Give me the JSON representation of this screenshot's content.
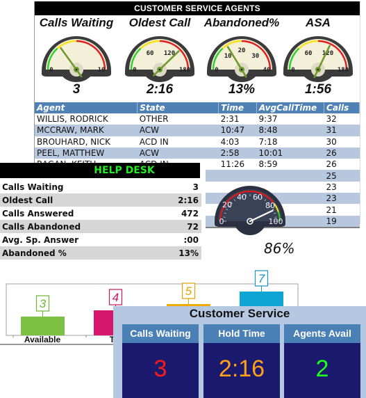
{
  "agents_panel": {
    "title": "CUSTOMER SERVICE AGENTS",
    "gauges": [
      {
        "label": "Calls Waiting",
        "value": "3",
        "min": 0,
        "max": 10,
        "ticks": [
          "0",
          "10"
        ],
        "needle": 3
      },
      {
        "label": "Oldest Call",
        "value": "2:16",
        "min": 0,
        "max": 180,
        "ticks": [
          "0",
          "60",
          "120",
          "180"
        ],
        "needle": 136
      },
      {
        "label": "Abandoned%",
        "value": "13%",
        "min": 0,
        "max": 40,
        "ticks": [
          "0",
          "10",
          "20",
          "30",
          "40"
        ],
        "needle": 13
      },
      {
        "label": "ASA",
        "value": "1:56",
        "min": 0,
        "max": 180,
        "ticks": [
          "0",
          "60",
          "120",
          "180"
        ],
        "needle": 116
      }
    ],
    "table": {
      "columns": [
        "Agent",
        "State",
        "Time",
        "AvgCallTime",
        "Calls"
      ],
      "rows": [
        [
          "WILLIS, RODRICK",
          "OTHER",
          "2:31",
          "9:37",
          "32"
        ],
        [
          "MCCRAW, MARK",
          "ACW",
          "10:47",
          "8:48",
          "31"
        ],
        [
          "BROUHARD, NICK",
          "ACD IN",
          "4:03",
          "7:18",
          "30"
        ],
        [
          "PEEL, MATTHEW",
          "ACW",
          "2:58",
          "10:01",
          "26"
        ],
        [
          "RAGAN, KEITH",
          "ACD IN",
          "11:26",
          "8:59",
          "26"
        ],
        [
          "",
          "",
          "",
          "",
          "25"
        ],
        [
          "",
          "",
          "",
          "",
          "23"
        ],
        [
          "",
          "",
          "",
          "",
          "23"
        ],
        [
          "",
          "",
          "",
          "",
          "21"
        ],
        [
          "",
          "",
          "",
          "",
          "19"
        ]
      ]
    }
  },
  "helpdesk": {
    "title": "HELP DESK",
    "title_color": "#22ee22",
    "rows": [
      {
        "label": "Calls Waiting",
        "value": "3"
      },
      {
        "label": "Oldest Call",
        "value": "2:16"
      },
      {
        "label": "Calls Answered",
        "value": "472"
      },
      {
        "label": "Calls Abandoned",
        "value": "72"
      },
      {
        "label": "Avg. Sp. Answer",
        "value": ":00"
      },
      {
        "label": "Abandoned %",
        "value": "13%"
      }
    ]
  },
  "service_level_gauge": {
    "value": "86%",
    "needle": 86,
    "min": 0,
    "max": 100,
    "ticks": [
      "0",
      "20",
      "40",
      "60",
      "80",
      "100"
    ]
  },
  "chart_data": {
    "type": "bar",
    "categories": [
      "Available",
      "Talking",
      "",
      ""
    ],
    "visible_category_labels": [
      "Available",
      "Tal"
    ],
    "values": [
      3,
      4,
      5,
      7
    ],
    "colors": [
      "#7cc242",
      "#d6166f",
      "#f2aa00",
      "#0ea5d5"
    ],
    "label_colors": [
      "#6bb72f",
      "#c2185b",
      "#e0a000",
      "#1691c0"
    ],
    "title": "",
    "xlabel": "",
    "ylabel": "",
    "ylim": [
      0,
      6
    ],
    "grid": false
  },
  "customer_service": {
    "title": "Customer Service",
    "tiles": [
      {
        "label": "Calls Waiting",
        "value": "3",
        "color": "#ff1a1a"
      },
      {
        "label": "Hold Time",
        "value": "2:16",
        "color": "#ffa21a"
      },
      {
        "label": "Agents Avail",
        "value": "2",
        "color": "#1aff1a"
      }
    ]
  }
}
